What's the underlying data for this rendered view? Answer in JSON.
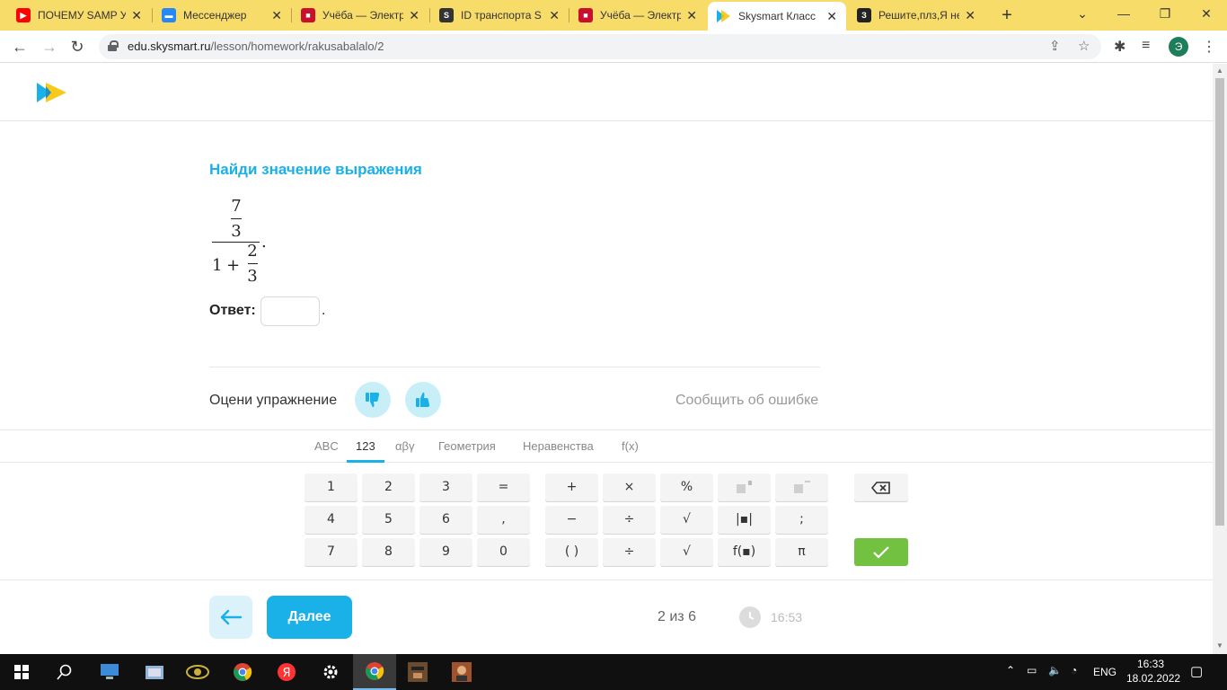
{
  "browser": {
    "tabs": [
      {
        "title": "ПОЧЕМУ SAMP У",
        "icon": "youtube-icon"
      },
      {
        "title": "Мессенджер",
        "icon": "messenger-icon"
      },
      {
        "title": "Учёба — Электр",
        "icon": "school-icon"
      },
      {
        "title": "ID транспорта S",
        "icon": "samp-icon"
      },
      {
        "title": "Учёба — Электр",
        "icon": "school-icon"
      },
      {
        "title": "Skysmart Класс",
        "icon": "skysmart-icon"
      },
      {
        "title": "Решите,плз,Я не",
        "icon": "znanija-icon"
      }
    ],
    "url_host": "edu.skysmart.ru",
    "url_path": "/lesson/homework/rakusabalalo/2",
    "profile_initial": "Э"
  },
  "task": {
    "title": "Найди значение выражения",
    "expr": {
      "num_n": "7",
      "num_d": "3",
      "den_whole": "1",
      "den_op": "+",
      "den_n": "2",
      "den_d": "3",
      "end": "."
    },
    "answer_label": "Ответ:",
    "answer_value": "",
    "answer_end": "."
  },
  "rating": {
    "label": "Оцени упражнение",
    "report": "Сообщить об ошибке"
  },
  "keyboard": {
    "tabs": [
      "ABC",
      "123",
      "αβγ",
      "Геометрия",
      "Неравенства",
      "f(x)"
    ],
    "active_tab": "123",
    "row1": [
      "1",
      "2",
      "3",
      "=",
      "+",
      "×",
      "%"
    ],
    "row2": [
      "4",
      "5",
      "6",
      ",",
      "−",
      "÷",
      "√",
      "|▪|",
      ";"
    ],
    "row3": [
      "7",
      "8",
      "9",
      "0",
      "( )",
      "÷",
      "√",
      "f(▪)",
      "π"
    ]
  },
  "footer": {
    "next_label": "Далее",
    "progress": "2 из 6",
    "timer": "16:53"
  },
  "taskbar": {
    "lang": "ENG",
    "time": "16:33",
    "date": "18.02.2022"
  },
  "colors": {
    "accent": "#1ab0e8",
    "ok": "#72c141",
    "tabstrip": "#f8dc6a"
  }
}
